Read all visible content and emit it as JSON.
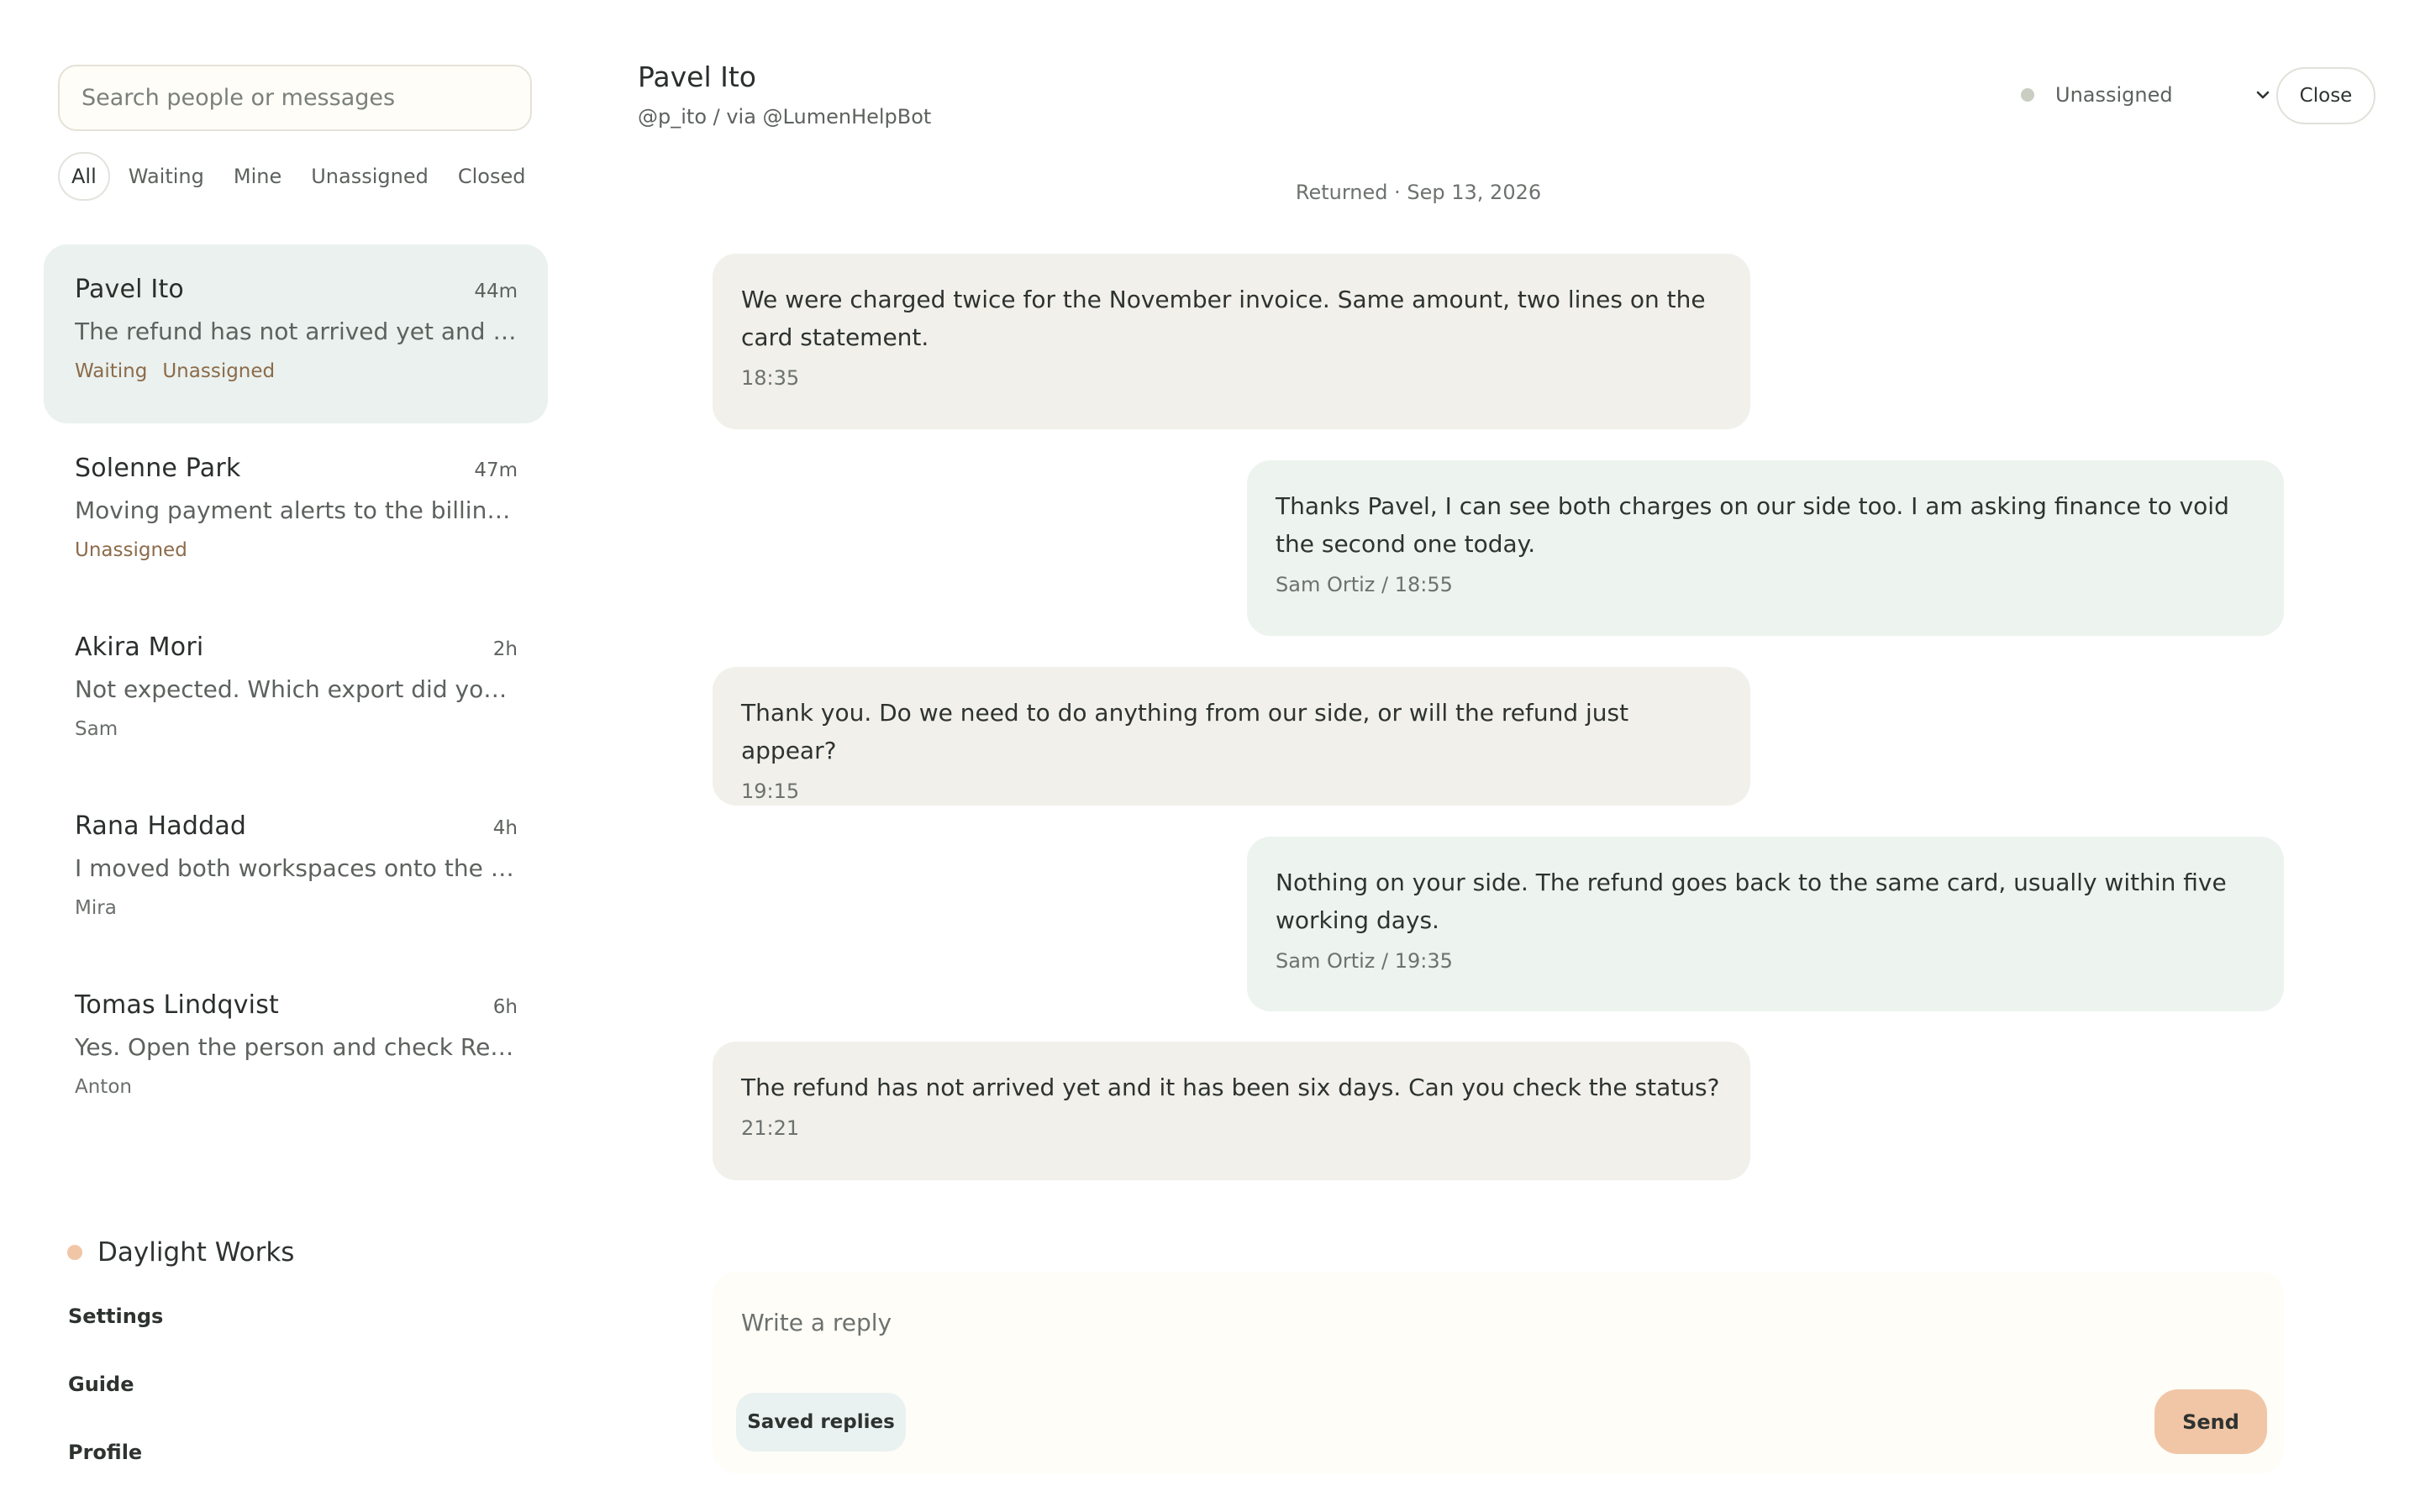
{
  "search": {
    "placeholder": "Search people or messages"
  },
  "filters": [
    {
      "label": "All",
      "active": true
    },
    {
      "label": "Waiting"
    },
    {
      "label": "Mine"
    },
    {
      "label": "Unassigned"
    },
    {
      "label": "Closed"
    }
  ],
  "conversations": [
    {
      "name": "Pavel Ito",
      "time": "44m",
      "preview": "The refund has not arrived yet and it has been six days. Can you check the status?",
      "status": "Waiting",
      "assignee": "Unassigned",
      "selected": true
    },
    {
      "name": "Solenne Park",
      "time": "47m",
      "preview": "Moving payment alerts to the billing team channel this week.",
      "status": "",
      "assignee": "Unassigned"
    },
    {
      "name": "Akira Mori",
      "time": "2h",
      "preview": "Not expected. Which export did you use for the report?",
      "status": "",
      "assignee": "Sam"
    },
    {
      "name": "Rana Haddad",
      "time": "4h",
      "preview": "I moved both workspaces onto the team plan yesterday.",
      "status": "",
      "assignee": "Mira"
    },
    {
      "name": "Tomas Lindqvist",
      "time": "6h",
      "preview": "Yes. Open the person and check Recent activity.",
      "status": "",
      "assignee": "Anton"
    }
  ],
  "workspace": {
    "name": "Daylight Works",
    "dot_color": "#f1c6a6"
  },
  "side_links": [
    "Settings",
    "Guide",
    "Profile"
  ],
  "header": {
    "title": "Pavel Ito",
    "subtitle": "@p_ito / via @LumenHelpBot",
    "assignee": "Unassigned",
    "close_label": "Close"
  },
  "thread": {
    "date_separator": "Returned · Sep 13, 2026",
    "messages": [
      {
        "direction": "in",
        "text": "We were charged twice for the November invoice. Same amount, two lines on the card statement.",
        "meta": "18:35"
      },
      {
        "direction": "out",
        "text": "Thanks Pavel, I can see both charges on our side too. I am asking finance to void the second one today.",
        "meta": "Sam Ortiz / 18:55"
      },
      {
        "direction": "in",
        "text": "Thank you. Do we need to do anything from our side, or will the refund just appear?",
        "meta": "19:15"
      },
      {
        "direction": "out",
        "text": "Nothing on your side. The refund goes back to the same card, usually within five working days.",
        "meta": "Sam Ortiz / 19:35"
      },
      {
        "direction": "in",
        "text": "The refund has not arrived yet and it has been six days. Can you check the status?",
        "meta": "21:21"
      }
    ]
  },
  "composer": {
    "placeholder": "Write a reply",
    "saved_replies_label": "Saved replies",
    "send_label": "Send"
  },
  "colors": {
    "selected_bg": "#eaf1ee",
    "incoming_bubble": "#f1f0eb",
    "outgoing_bubble": "#edf3ef",
    "accent": "#f1c6a6",
    "status_text": "#8c6b4a"
  }
}
